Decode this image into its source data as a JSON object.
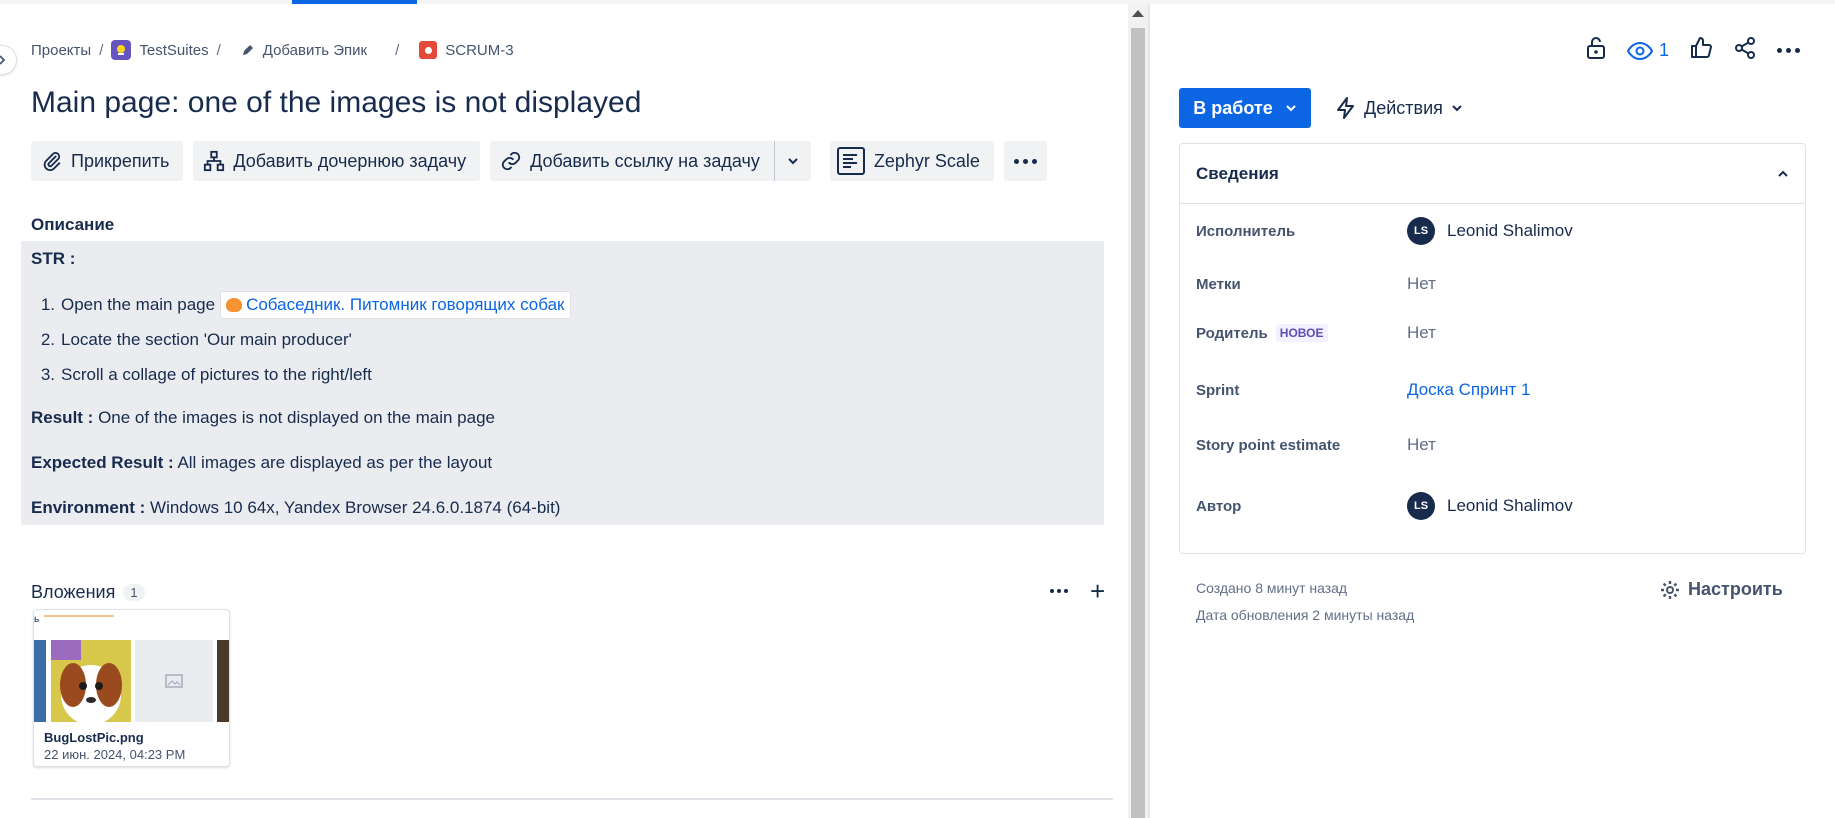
{
  "breadcrumb": {
    "projects": "Проекты",
    "project": "TestSuites",
    "add_epic": "Добавить Эпик",
    "issue_key": "SCRUM-3"
  },
  "issue": {
    "title": "Main page: one of the images is not displayed"
  },
  "toolbar": {
    "attach": "Прикрепить",
    "add_child": "Добавить дочернюю задачу",
    "add_link": "Добавить ссылку на задачу",
    "zephyr": "Zephyr Scale"
  },
  "description": {
    "label": "Описание",
    "str_label": "STR :",
    "steps": [
      {
        "num": "1.",
        "text": "Open the main page",
        "link": "Собаседник. Питомник говорящих собак"
      },
      {
        "num": "2.",
        "text": "Locate the section 'Our main producer'"
      },
      {
        "num": "3.",
        "text": "Scroll a collage of pictures to the right/left"
      }
    ],
    "result_label": "Result :",
    "result_text": " One of the images is not displayed on the main page",
    "expected_label": "Expected Result :",
    "expected_text": " All images are displayed as per the layout",
    "env_label": "Environment :",
    "env_text": " Windows 10 64x, Yandex Browser 24.6.0.1874 (64-bit)"
  },
  "attachments": {
    "label": "Вложения",
    "count": "1",
    "file_name": "BugLostPic.png",
    "file_date": "22 июн. 2024, 04:23 PM",
    "thumb_mark": "ь"
  },
  "header_right": {
    "watchers": "1"
  },
  "status": {
    "label": "В работе",
    "actions": "Действия"
  },
  "details": {
    "title": "Сведения",
    "fields": [
      {
        "label": "Исполнитель",
        "value": "Leonid Shalimov",
        "avatar": "LS"
      },
      {
        "label": "Метки",
        "value": "Нет"
      },
      {
        "label": "Родитель",
        "badge": "НОВОЕ",
        "value": "Нет"
      },
      {
        "label": "Sprint",
        "value": "Доска Спринт 1"
      },
      {
        "label": "Story point estimate",
        "value": "Нет"
      },
      {
        "label": "Автор",
        "value": "Leonid Shalimov",
        "avatar": "LS"
      }
    ]
  },
  "meta": {
    "created": "Создано 8 минут назад",
    "updated": "Дата обновления 2 минуты назад",
    "configure": "Настроить"
  },
  "colors": {
    "primary": "#0c66e4",
    "text": "#172b4d",
    "desc_bg": "#ebecf0",
    "new_badge": "#5e4db2"
  }
}
